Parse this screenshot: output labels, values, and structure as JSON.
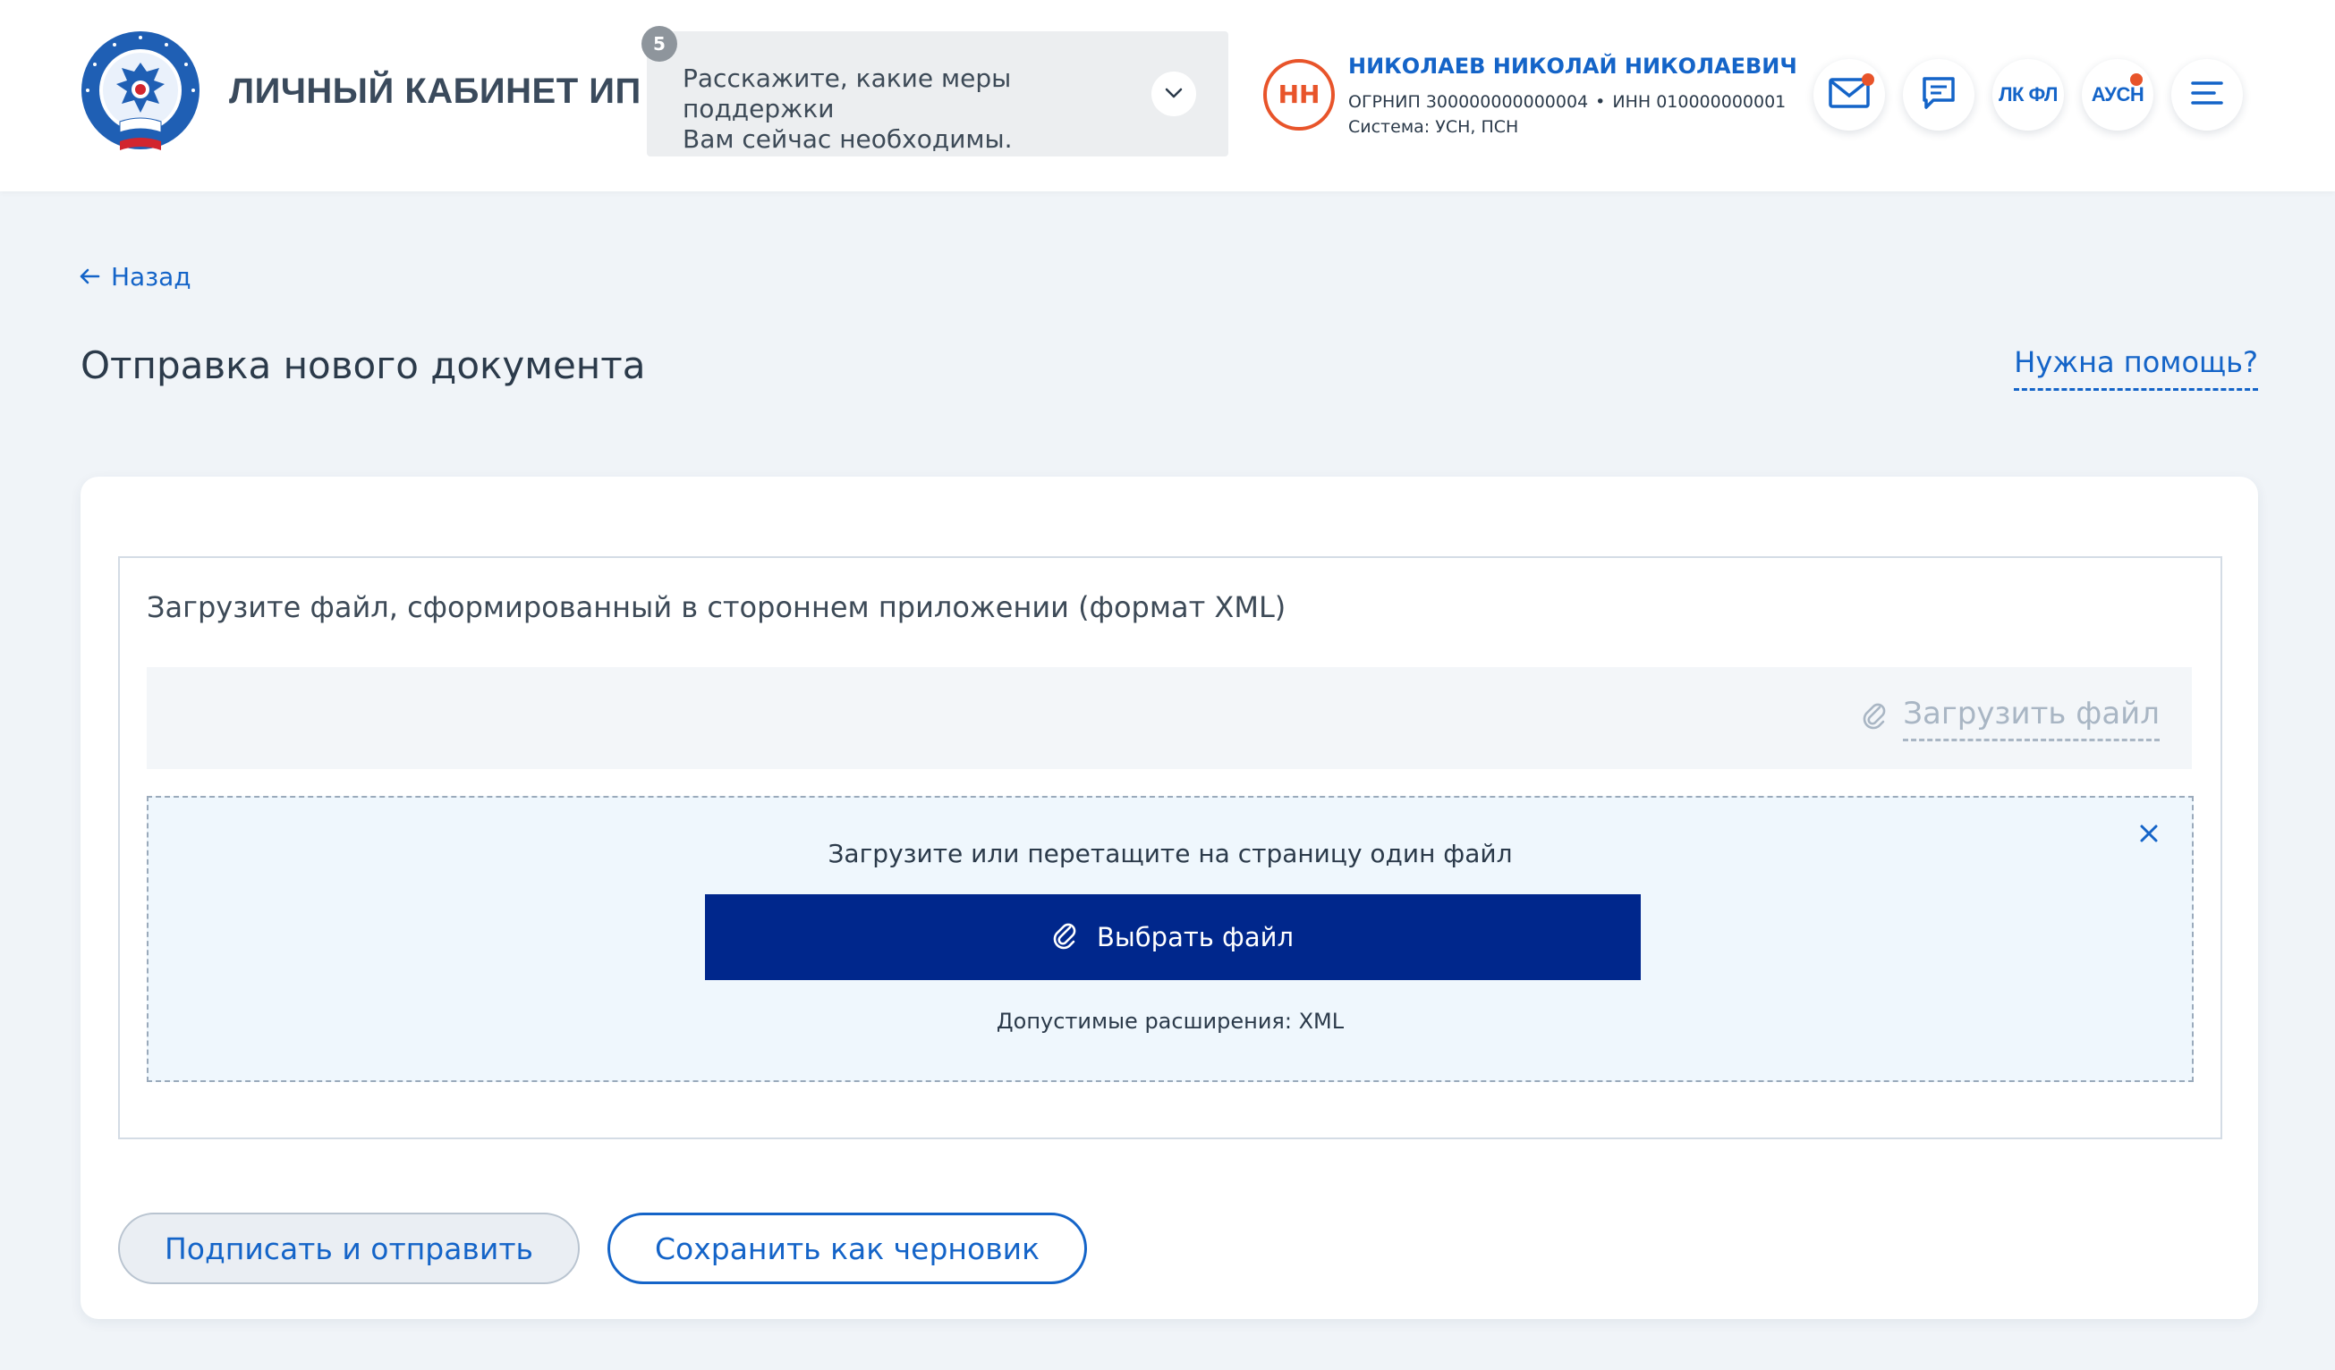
{
  "header": {
    "brand_title": "ЛИЧНЫЙ КАБИНЕТ ИП",
    "logo_icon": "fns-emblem-icon",
    "survey": {
      "badge": "5",
      "line1": "Расскажите, какие меры поддержки",
      "line2": "Вам сейчас необходимы."
    },
    "user": {
      "initials": "НН",
      "name": "НИКОЛАЕВ НИКОЛАЙ НИКОЛАЕВИЧ",
      "ogrnip": "ОГРНИП 300000000000004",
      "separator": "•",
      "inn": "ИНН 010000000001",
      "system": "Система: УСН, ПСН"
    },
    "actions": {
      "lk_fl": "ЛК ФЛ",
      "ausn": "АУСН"
    },
    "colors": {
      "accent": "#1464c8",
      "notification": "#e8542a"
    }
  },
  "page": {
    "back_label": "Назад",
    "title": "Отправка нового документа",
    "help_label": "Нужна помощь?"
  },
  "upload": {
    "label": "Загрузите файл, сформированный в стороннем приложении (формат XML)",
    "upload_link": "Загрузить файл",
    "dropzone": {
      "text": "Загрузите или перетащите на страницу один файл",
      "button": "Выбрать файл",
      "extensions": "Допустимые расширения: XML"
    }
  },
  "actions": {
    "sign_and_send": "Подписать и отправить",
    "save_draft": "Сохранить как черновик"
  }
}
